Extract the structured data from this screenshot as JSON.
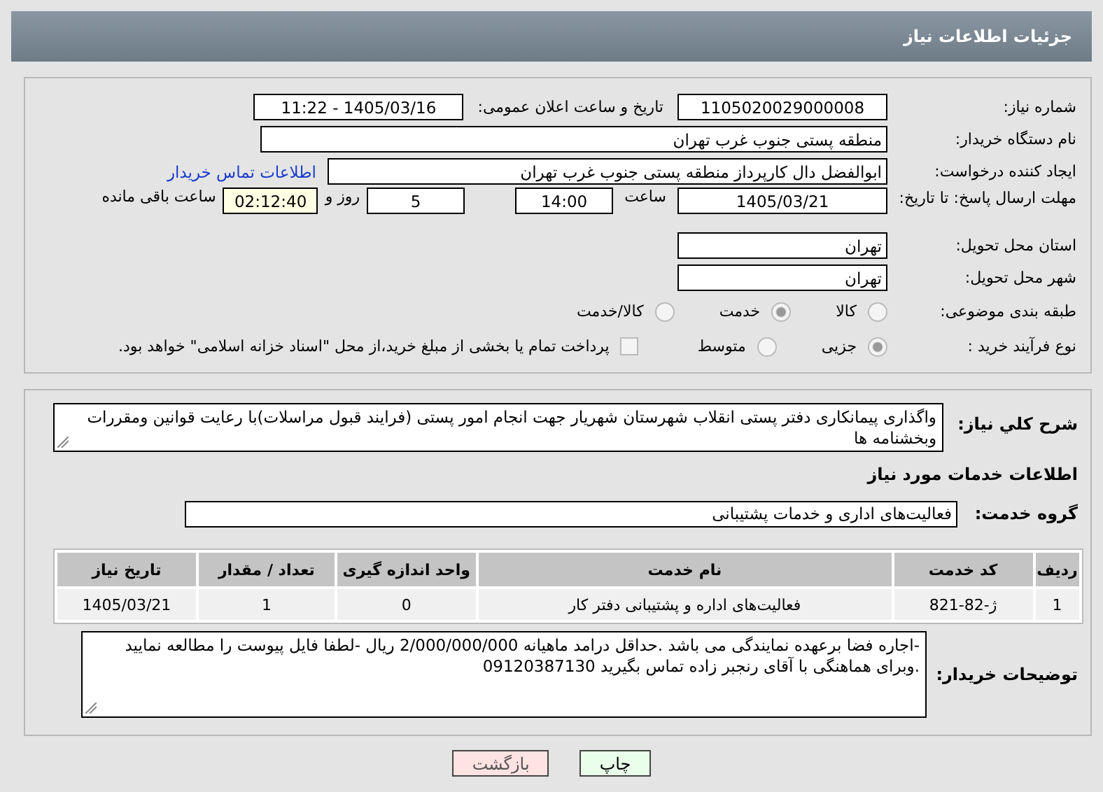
{
  "header": {
    "title": "جزئیات اطلاعات نیاز"
  },
  "need_number": {
    "label": "شماره نیاز:",
    "value": "1105020029000008"
  },
  "announce": {
    "label": "تاریخ و ساعت اعلان عمومی:",
    "value": "1405/03/16 - 11:22"
  },
  "buyer": {
    "label": "نام دستگاه خریدار:",
    "value": "منطقه پستی جنوب غرب تهران"
  },
  "creator": {
    "label": "ایجاد کننده درخواست:",
    "value": "ابوالفضل  دال  کارپرداز منطقه پستی جنوب غرب تهران",
    "link": "اطلاعات تماس خریدار"
  },
  "deadline": {
    "label": "مهلت ارسال پاسخ: تا تاریخ:",
    "date": "1405/03/21",
    "time_label": "ساعت",
    "time": "14:00",
    "days": "5",
    "days_label": "روز و",
    "remaining": "02:12:40",
    "remaining_label": "ساعت باقی مانده"
  },
  "province": {
    "label": "استان محل تحویل:",
    "value": "تهران"
  },
  "city": {
    "label": "شهر محل تحویل:",
    "value": "تهران"
  },
  "category": {
    "label": "طبقه بندی موضوعی:",
    "options": [
      {
        "label": "کالا",
        "selected": false
      },
      {
        "label": "خدمت",
        "selected": true
      },
      {
        "label": "کالا/خدمت",
        "selected": false
      }
    ]
  },
  "process": {
    "label": "نوع فرآیند خرید :",
    "options": [
      {
        "label": "جزیی",
        "selected": true
      },
      {
        "label": "متوسط",
        "selected": false
      }
    ],
    "payment": {
      "label": "پرداخت تمام یا بخشی از مبلغ خرید،از محل \"اسناد خزانه اسلامی\" خواهد بود.",
      "checked": false
    }
  },
  "description": {
    "label": "شرح کلي نياز:",
    "value": "واگذاری پیمانکاری دفتر پستی انقلاب شهرستان شهریار جهت انجام امور پستی (فرایند قبول مراسلات)با رعایت قوانین ومقررات وبخشنامه ها"
  },
  "services_title": "اطلاعات خدمات مورد نیاز",
  "service_group": {
    "label": "گروه خدمت:",
    "value": "فعالیت‌های اداری و خدمات پشتیبانی"
  },
  "table": {
    "columns": [
      "ردیف",
      "کد خدمت",
      "نام خدمت",
      "واحد اندازه گیری",
      "تعداد / مقدار",
      "تاریخ نیاز"
    ],
    "rows": [
      [
        "1",
        "ژ-82-821",
        "فعالیت‌های اداره و پشتیبانی دفتر کار",
        "0",
        "1",
        "1405/03/21"
      ]
    ]
  },
  "buyer_notes": {
    "label": "توضیحات خریدار:",
    "value": "-اجاره فضا برعهده نمایندگی می باشد .حداقل درامد ماهیانه 2/000/000/000 ریال -لطفا فایل پیوست را مطالعه نمایید .وبرای هماهنگی با آقای رنجبر زاده تماس بگیرید 09120387130"
  },
  "buttons": [
    {
      "label": "چاپ",
      "kind": "print"
    },
    {
      "label": "بازگشت",
      "kind": "back"
    }
  ]
}
